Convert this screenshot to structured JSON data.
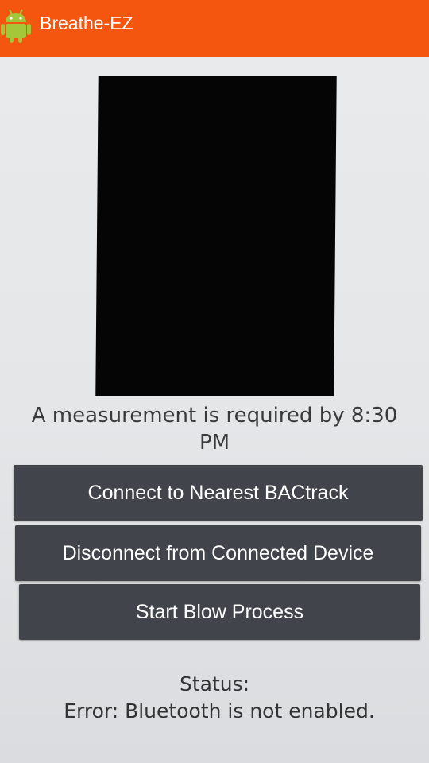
{
  "app_bar": {
    "icon": "android-icon",
    "title": "Breathe-EZ",
    "color": "#f4550f"
  },
  "main": {
    "measurement_message_line1": "A measurement is required by 8:30",
    "measurement_message_line2": "PM",
    "buttons": {
      "connect_label": "Connect to Nearest BACtrack",
      "disconnect_label": "Disconnect from Connected Device",
      "start_blow_label": "Start Blow Process"
    },
    "status": {
      "label": "Status:",
      "text": "Error: Bluetooth is not enabled."
    }
  },
  "colors": {
    "button_background": "#41444b",
    "image_area": "#050505",
    "background": "#e8e9eb"
  }
}
